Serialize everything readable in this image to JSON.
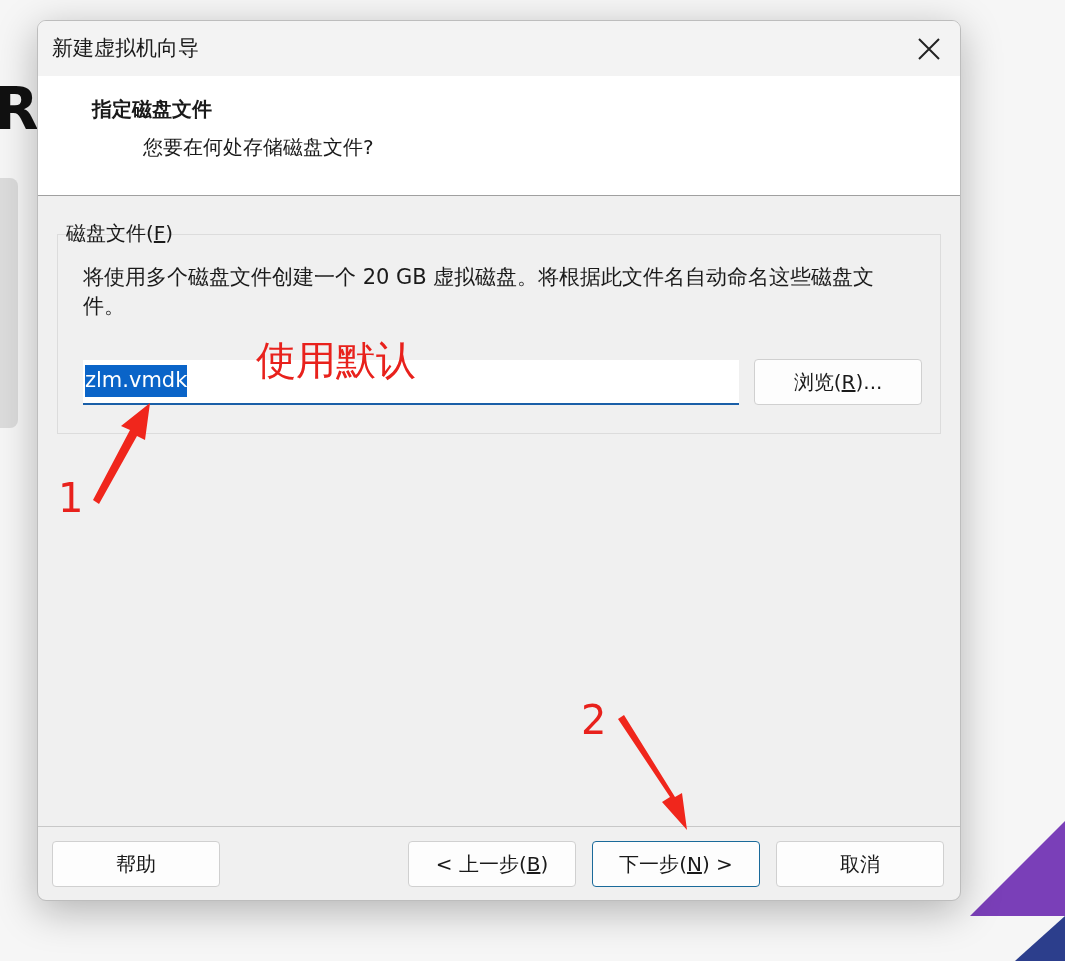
{
  "background": {
    "text": "R"
  },
  "window": {
    "title": "新建虚拟机向导"
  },
  "header": {
    "title": "指定磁盘文件",
    "subtitle": "您要在何处存储磁盘文件?"
  },
  "disk_group": {
    "label": [
      {
        "text": "磁盘文件(",
        "underline": false
      },
      {
        "text": "F",
        "underline": true
      },
      {
        "text": ")",
        "underline": false
      }
    ],
    "description": "将使用多个磁盘文件创建一个 20 GB 虚拟磁盘。将根据此文件名自动命名这些磁盘文件。",
    "file_field": {
      "value": "zlm.vmdk",
      "selected": true
    },
    "browse_button": [
      {
        "text": "浏览(",
        "underline": false
      },
      {
        "text": "R",
        "underline": true
      },
      {
        "text": ")...",
        "underline": false
      }
    ]
  },
  "buttons": [
    {
      "default": false,
      "parts": [
        {
          "text": "帮助",
          "underline": false
        }
      ]
    },
    {
      "default": false,
      "parts": [
        {
          "text": "< 上一步(",
          "underline": false
        },
        {
          "text": "B",
          "underline": true
        },
        {
          "text": ")",
          "underline": false
        }
      ]
    },
    {
      "default": true,
      "parts": [
        {
          "text": "下一步(",
          "underline": false
        },
        {
          "text": "N",
          "underline": true
        },
        {
          "text": ") >",
          "underline": false
        }
      ]
    },
    {
      "default": false,
      "parts": [
        {
          "text": "取消",
          "underline": false
        }
      ]
    }
  ],
  "annotations": [
    {
      "kind": "callout",
      "text": "使用默认"
    },
    {
      "kind": "step",
      "text": "1"
    },
    {
      "kind": "arrow"
    },
    {
      "kind": "step",
      "text": "2"
    },
    {
      "kind": "arrow"
    }
  ]
}
